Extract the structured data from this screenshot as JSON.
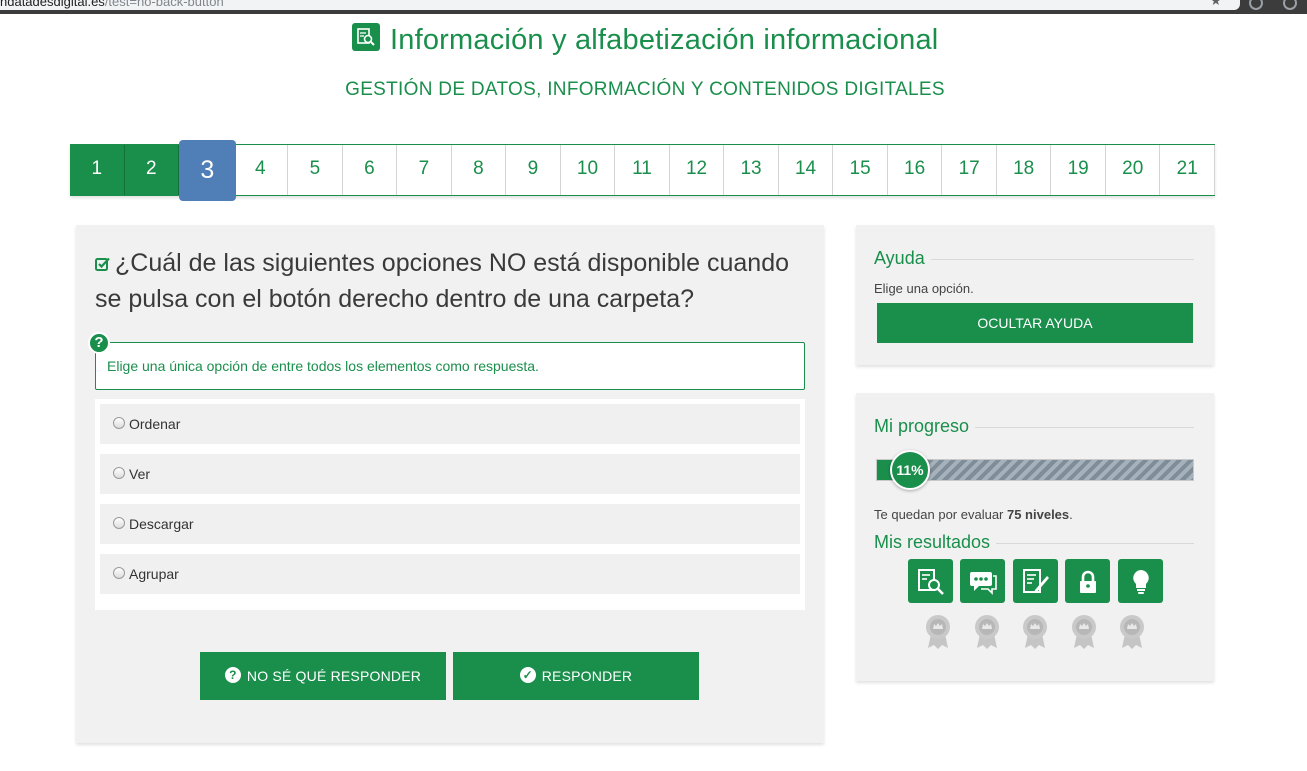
{
  "browser": {
    "url_host": "ndatadesdigital.es",
    "url_path": "/test=no-back-button"
  },
  "header": {
    "title": "Información y alfabetización informacional",
    "subtitle": "GESTIÓN DE DATOS, INFORMACIÓN Y CONTENIDOS DIGITALES",
    "title_icon": "search-document-icon"
  },
  "pager": {
    "pages": [
      "1",
      "2",
      "3",
      "4",
      "5",
      "6",
      "7",
      "8",
      "9",
      "10",
      "11",
      "12",
      "13",
      "14",
      "15",
      "16",
      "17",
      "18",
      "19",
      "20",
      "21"
    ],
    "completed": [
      1,
      2
    ],
    "current": 3
  },
  "question": {
    "text": "¿Cuál de las siguientes opciones NO está disponible cuando se pulsa con el botón derecho dentro de una carpeta?",
    "instruction": "Elige una única opción de entre todos los elementos como respuesta.",
    "options": [
      "Ordenar",
      "Ver",
      "Descargar",
      "Agrupar"
    ],
    "buttons": {
      "dont_know": "NO SÉ QUÉ RESPONDER",
      "answer": "RESPONDER"
    }
  },
  "help_panel": {
    "title": "Ayuda",
    "text": "Elige una opción.",
    "hide_button": "OCULTAR AYUDA"
  },
  "progress_panel": {
    "title": "Mi progreso",
    "percent_label": "11%",
    "percent": 11,
    "remaining_prefix": "Te quedan por evaluar ",
    "remaining_count": "75 niveles",
    "remaining_suffix": ".",
    "results_title": "Mis resultados",
    "areas": [
      "search-document-icon",
      "chat-icon",
      "edit-document-icon",
      "lock-icon",
      "lightbulb-icon"
    ]
  },
  "colors": {
    "primary": "#1a8f4c",
    "current_page": "#4f7fb6",
    "panel_bg": "#f1f1f1"
  }
}
